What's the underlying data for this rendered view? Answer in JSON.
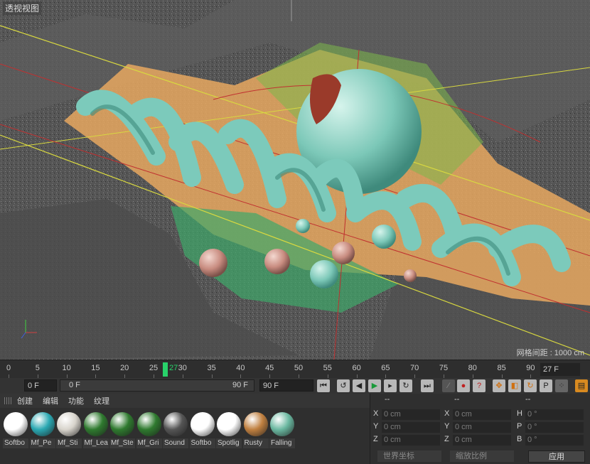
{
  "viewport": {
    "title": "透视视图",
    "grid_spacing": "网格间距 : 1000 cm"
  },
  "timeline": {
    "ticks": [
      "0",
      "5",
      "10",
      "15",
      "20",
      "25",
      "30",
      "35",
      "40",
      "45",
      "50",
      "55",
      "60",
      "65",
      "70",
      "75",
      "80",
      "85",
      "90"
    ],
    "current": "27",
    "current_frame_field": "27 F"
  },
  "transport": {
    "start_field": "0 F",
    "range_start": "0 F",
    "range_end": "90 F",
    "end_field": "90 F"
  },
  "materials": {
    "menu": [
      "创建",
      "编辑",
      "功能",
      "纹理"
    ],
    "items": [
      {
        "name": "Softbo",
        "color": "#ffffff"
      },
      {
        "name": "Mf_Pe",
        "color": "#2aa8b2"
      },
      {
        "name": "Mf_Sti",
        "color": "#d8d4cc"
      },
      {
        "name": "Mf_Lea",
        "color": "#2f7a2f"
      },
      {
        "name": "Mf_Ste",
        "color": "#2f7a2f"
      },
      {
        "name": "Mf_Gri",
        "color": "#2f7a2f"
      },
      {
        "name": "Sound",
        "color": "#555555"
      },
      {
        "name": "Softbo",
        "color": "#ffffff"
      },
      {
        "name": "Spotlig",
        "color": "#ffffff"
      },
      {
        "name": "Rusty",
        "color": "#c08040"
      },
      {
        "name": "Falling",
        "color": "#6ab8a0"
      }
    ]
  },
  "coords": {
    "headers": [
      "--",
      "--",
      "--"
    ],
    "rows": [
      {
        "a": "X",
        "av": "0 cm",
        "b": "X",
        "bv": "0 cm",
        "c": "H",
        "cv": "0 °"
      },
      {
        "a": "Y",
        "av": "0 cm",
        "b": "Y",
        "bv": "0 cm",
        "c": "P",
        "cv": "0 °"
      },
      {
        "a": "Z",
        "av": "0 cm",
        "b": "Z",
        "bv": "0 cm",
        "c": "B",
        "cv": "0 °"
      }
    ],
    "world_dropdown": "世界坐标",
    "scale_dropdown": "缩放比例",
    "apply": "应用"
  }
}
